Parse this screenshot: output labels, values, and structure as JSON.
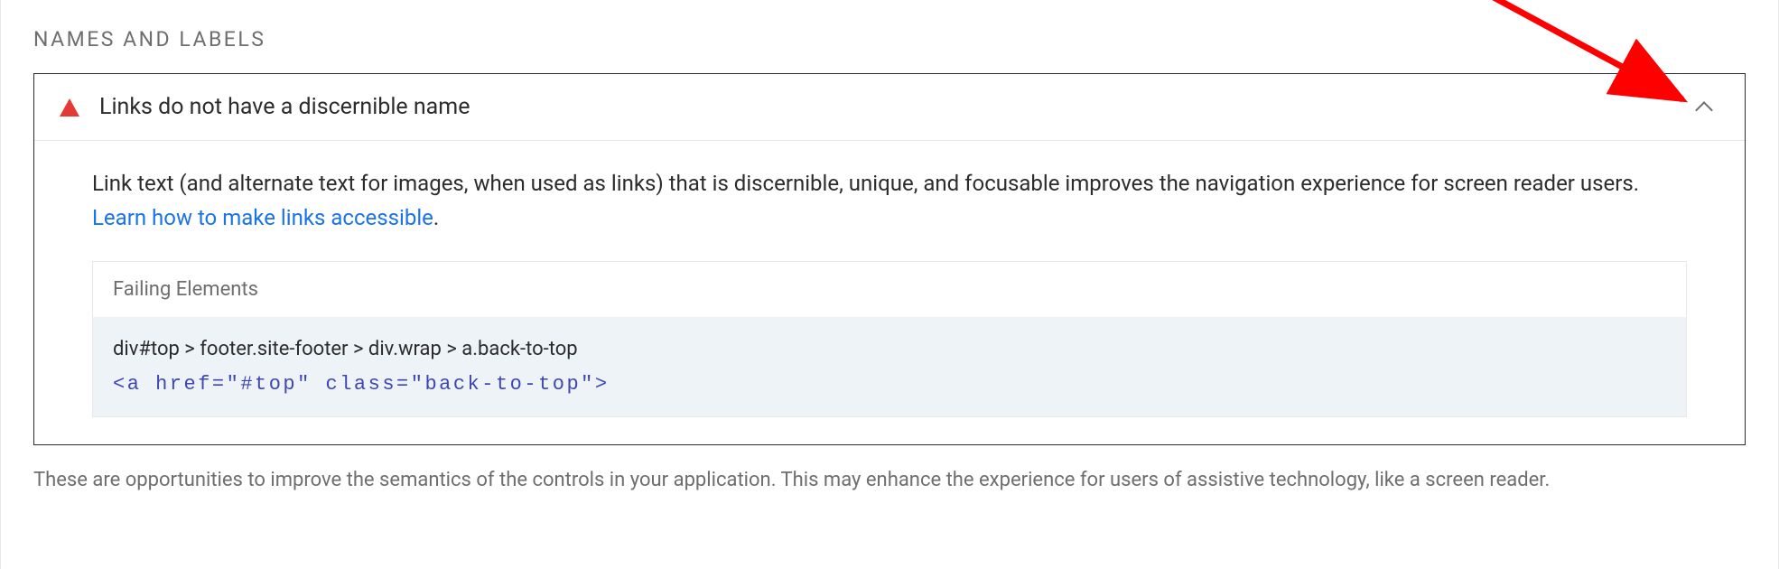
{
  "section": {
    "title": "NAMES AND LABELS"
  },
  "audit": {
    "title": "Links do not have a discernible name",
    "description_pre": "Link text (and alternate text for images, when used as links) that is discernible, unique, and focusable improves the navigation experience for screen reader users. ",
    "learn_link": "Learn how to make links accessible",
    "period": "."
  },
  "failing": {
    "header": "Failing Elements",
    "selector": "div#top > footer.site-footer > div.wrap > a.back-to-top",
    "snippet": "<a href=\"#top\" class=\"back-to-top\">"
  },
  "footer_note": "These are opportunities to improve the semantics of the controls in your application. This may enhance the experience for users of assistive technology, like a screen reader."
}
